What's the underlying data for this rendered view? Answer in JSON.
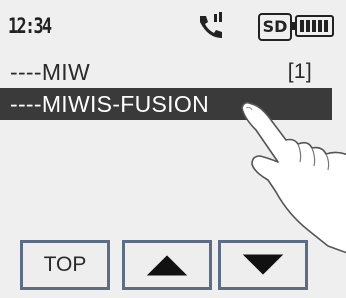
{
  "status_bar": {
    "time": "12:34",
    "signal_icon": "signal-handset-icon",
    "sd_label": "SD",
    "battery_icon": "battery-icon"
  },
  "list": {
    "items": [
      {
        "label": "----MIW",
        "count": "[1]"
      },
      {
        "label": "----MIWIS-FUSION",
        "count": ""
      }
    ],
    "selected_index": 1
  },
  "soft_keys": {
    "top_label": "TOP",
    "up_icon": "up-arrow-icon",
    "down_icon": "down-arrow-icon"
  },
  "colors": {
    "screen_bg": "#efefef",
    "selection_bg": "#3a3a3a",
    "key_border": "#5d6d85"
  }
}
